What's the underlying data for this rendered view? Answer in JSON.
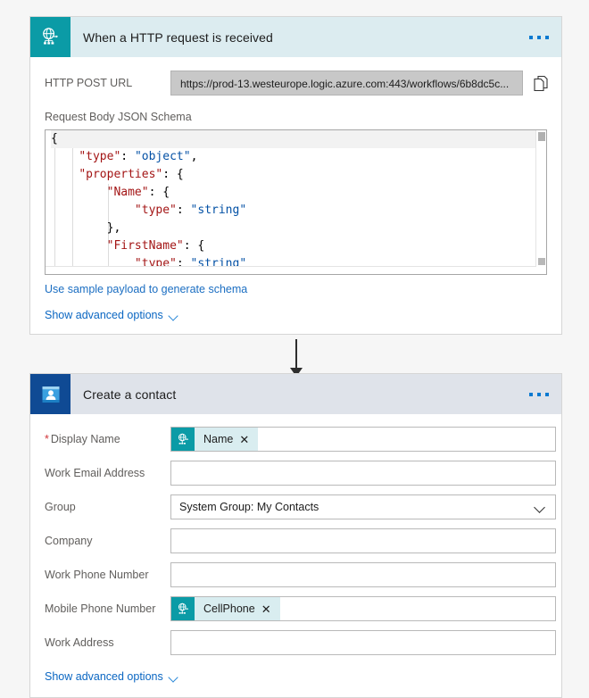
{
  "trigger": {
    "title": "When a HTTP request is received",
    "icon": "globe-network-icon",
    "menu": "more-options",
    "url_label": "HTTP POST URL",
    "url_value": "https://prod-13.westeurope.logic.azure.com:443/workflows/6b8dc5c...",
    "copy_icon": "copy-icon",
    "schema_label": "Request Body JSON Schema",
    "sample_payload_link": "Use sample payload to generate schema",
    "advanced_link": "Show advanced options",
    "code_lines": [
      [
        {
          "t": "p",
          "s": "{"
        }
      ],
      [
        {
          "t": "p",
          "s": "    "
        },
        {
          "t": "k",
          "s": "\"type\""
        },
        {
          "t": "p",
          "s": ": "
        },
        {
          "t": "v",
          "s": "\"object\""
        },
        {
          "t": "p",
          "s": ","
        }
      ],
      [
        {
          "t": "p",
          "s": "    "
        },
        {
          "t": "k",
          "s": "\"properties\""
        },
        {
          "t": "p",
          "s": ": {"
        }
      ],
      [
        {
          "t": "p",
          "s": "        "
        },
        {
          "t": "k",
          "s": "\"Name\""
        },
        {
          "t": "p",
          "s": ": {"
        }
      ],
      [
        {
          "t": "p",
          "s": "            "
        },
        {
          "t": "k",
          "s": "\"type\""
        },
        {
          "t": "p",
          "s": ": "
        },
        {
          "t": "v",
          "s": "\"string\""
        }
      ],
      [
        {
          "t": "p",
          "s": "        },"
        }
      ],
      [
        {
          "t": "p",
          "s": "        "
        },
        {
          "t": "k",
          "s": "\"FirstName\""
        },
        {
          "t": "p",
          "s": ": {"
        }
      ],
      [
        {
          "t": "p",
          "s": "            "
        },
        {
          "t": "k",
          "s": "\"type\""
        },
        {
          "t": "p",
          "s": ": "
        },
        {
          "t": "v",
          "s": "\"string\""
        }
      ],
      [
        {
          "t": "p",
          "s": "        }"
        }
      ]
    ]
  },
  "action": {
    "title": "Create a contact",
    "icon": "contact-card-icon",
    "menu": "more-options",
    "advanced_link": "Show advanced options",
    "fields": [
      {
        "label": "Display Name",
        "required": true,
        "type": "token",
        "token": {
          "label": "Name",
          "icon": "globe-network-icon",
          "remove": "✕"
        }
      },
      {
        "label": "Work Email Address",
        "required": false,
        "type": "text",
        "value": ""
      },
      {
        "label": "Group",
        "required": false,
        "type": "select",
        "value": "System Group: My Contacts"
      },
      {
        "label": "Company",
        "required": false,
        "type": "text",
        "value": ""
      },
      {
        "label": "Work Phone Number",
        "required": false,
        "type": "text",
        "value": ""
      },
      {
        "label": "Mobile Phone Number",
        "required": false,
        "type": "token",
        "token": {
          "label": "CellPhone",
          "icon": "globe-network-icon",
          "remove": "✕"
        }
      },
      {
        "label": "Work Address",
        "required": false,
        "type": "text",
        "value": ""
      }
    ]
  },
  "colors": {
    "trigger_header": "#dcecf0",
    "trigger_icon": "#0b9ba6",
    "action_header": "#dfe3ea",
    "action_icon": "#0f4a94",
    "link": "#0a66c2",
    "required": "#d13438",
    "token_bg": "#d9edf0"
  }
}
